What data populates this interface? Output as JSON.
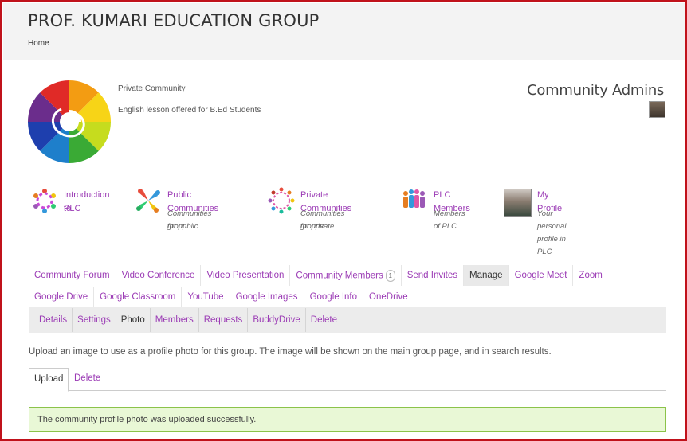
{
  "header": {
    "site_title": "PROF. KUMARI EDUCATION GROUP",
    "breadcrumb_home": "Home"
  },
  "group": {
    "privacy": "Private Community",
    "description": "English lesson offered for B.Ed Students",
    "admins_title": "Community Admins"
  },
  "quick_links": [
    {
      "title_line1": "Introduction to",
      "title_line2": "PLC",
      "icon": "people-circle-icon"
    },
    {
      "title": "Public Communities",
      "sub_line1": "Communities for public",
      "sub_line2": "group",
      "icon": "people-pinwheel-icon"
    },
    {
      "title": "Private Communities",
      "sub_line1": "Communities for private",
      "sub_line2": "groups",
      "icon": "people-ring-icon"
    },
    {
      "title": "PLC Members",
      "sub_line1": "Members of PLC",
      "icon": "members-group-icon"
    },
    {
      "title": "My Profile",
      "sub_line1": "Your personal profile in PLC",
      "icon": "profile-avatar"
    }
  ],
  "tabs_row1": [
    "Community Forum",
    "Video Conference",
    "Video Presentation",
    "Community Members",
    "Send Invites",
    "Manage",
    "Google Meet",
    "Zoom"
  ],
  "members_badge": "1",
  "tabs_row2": [
    "Google Drive",
    "Google Classroom",
    "YouTube",
    "Google Images",
    "Google Info",
    "OneDrive"
  ],
  "subnav": [
    "Details",
    "Settings",
    "Photo",
    "Members",
    "Requests",
    "BuddyDrive",
    "Delete"
  ],
  "photo": {
    "help_text": "Upload an image to use as a profile photo for this group. The image will be shown on the main group page, and in search results.",
    "tab_upload": "Upload",
    "tab_delete": "Delete",
    "success_message": "The community profile photo was uploaded successfully."
  },
  "colors": {
    "frame_border": "#c0121b",
    "link": "#9b3bb5",
    "success_bg": "#e9f8d6",
    "success_border": "#8bc34a"
  }
}
